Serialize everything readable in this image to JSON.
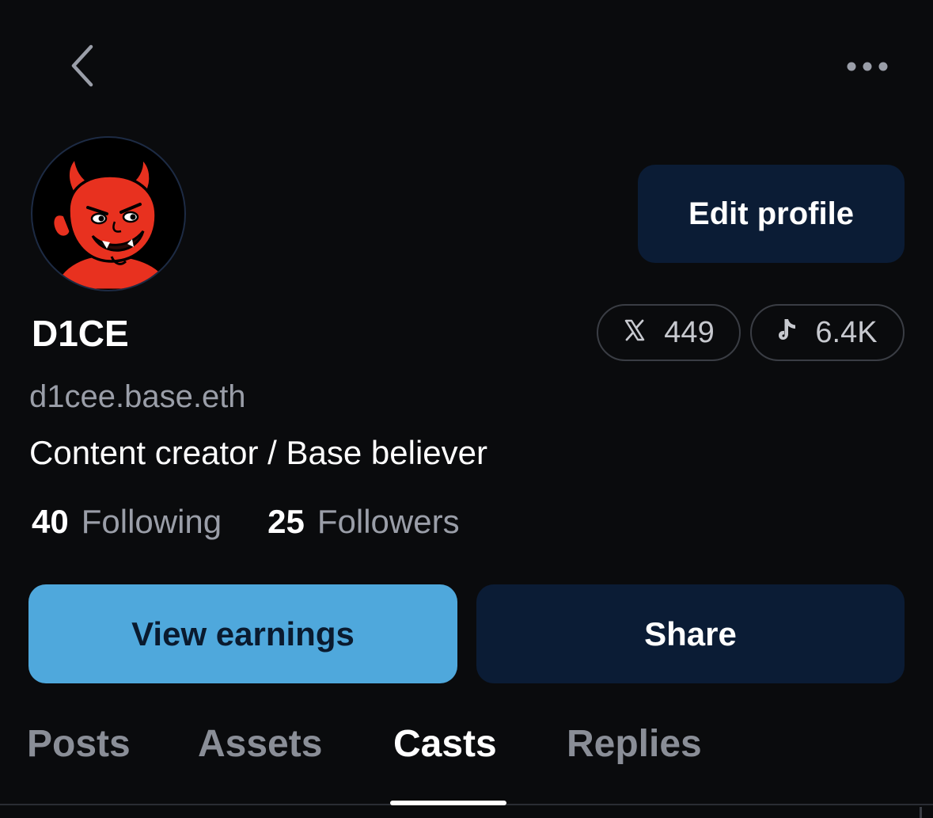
{
  "header": {
    "back_icon": "chevron-left-icon",
    "more_icon": "more-horizontal-icon"
  },
  "profile": {
    "display_name": "D1CE",
    "handle": "d1cee.base.eth",
    "bio": "Content creator / Base believer",
    "edit_label": "Edit profile",
    "avatar_icon": "devil-avatar"
  },
  "socials": [
    {
      "icon": "x-logo-icon",
      "count": "449"
    },
    {
      "icon": "tiktok-icon",
      "count": "6.4K"
    }
  ],
  "stats": {
    "following_count": "40",
    "following_label": "Following",
    "followers_count": "25",
    "followers_label": "Followers"
  },
  "actions": {
    "earnings_label": "View earnings",
    "share_label": "Share"
  },
  "tabs": [
    {
      "label": "Posts",
      "active": false
    },
    {
      "label": "Assets",
      "active": false
    },
    {
      "label": "Casts",
      "active": true
    },
    {
      "label": "Replies",
      "active": false
    }
  ],
  "colors": {
    "background": "#0a0b0d",
    "primary_button": "#4fa8dc",
    "secondary_button": "#0b1c35",
    "muted_text": "#9a9ea8",
    "avatar_red": "#e8311f"
  }
}
